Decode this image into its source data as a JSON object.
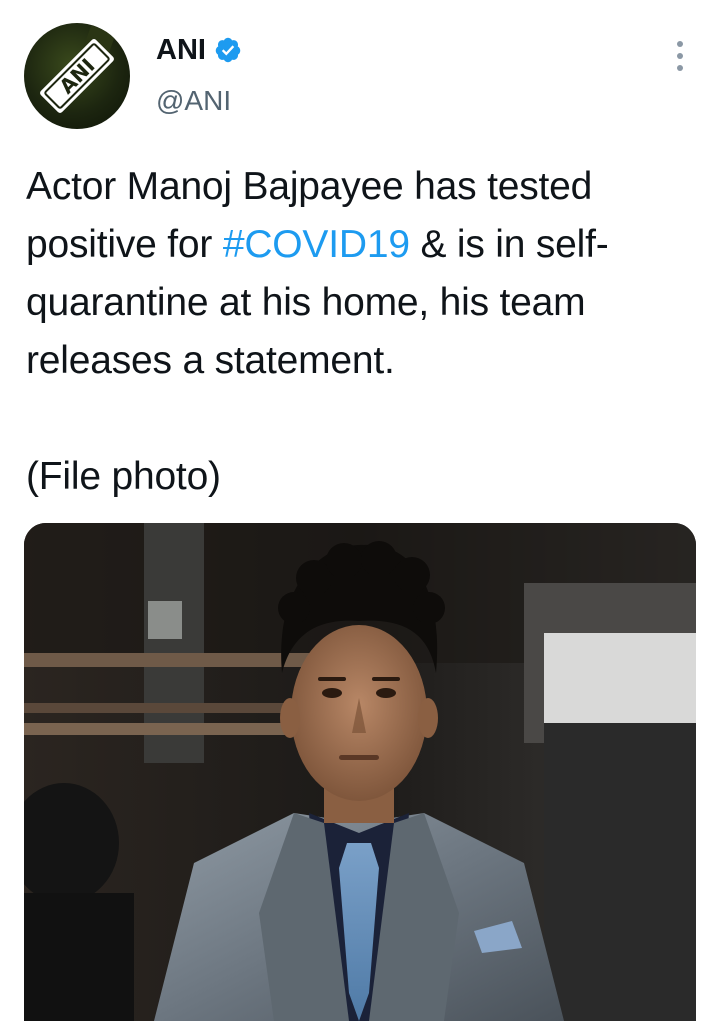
{
  "author": {
    "display_name": "ANI",
    "handle": "@ANI",
    "verified": true,
    "avatar_logo_text": "ANI"
  },
  "tweet": {
    "text_before_hashtag": "Actor Manoj Bajpayee has tested positive for ",
    "hashtag": "#COVID19",
    "text_after_hashtag": " & is in self-quarantine at his home, his team releases a statement.",
    "note": "(File photo)"
  },
  "colors": {
    "hashtag": "#1d9bf0",
    "verified_badge": "#1d9bf0",
    "handle": "#536471"
  },
  "icons": {
    "verified": "verified-badge-icon",
    "more": "more-options-icon"
  }
}
